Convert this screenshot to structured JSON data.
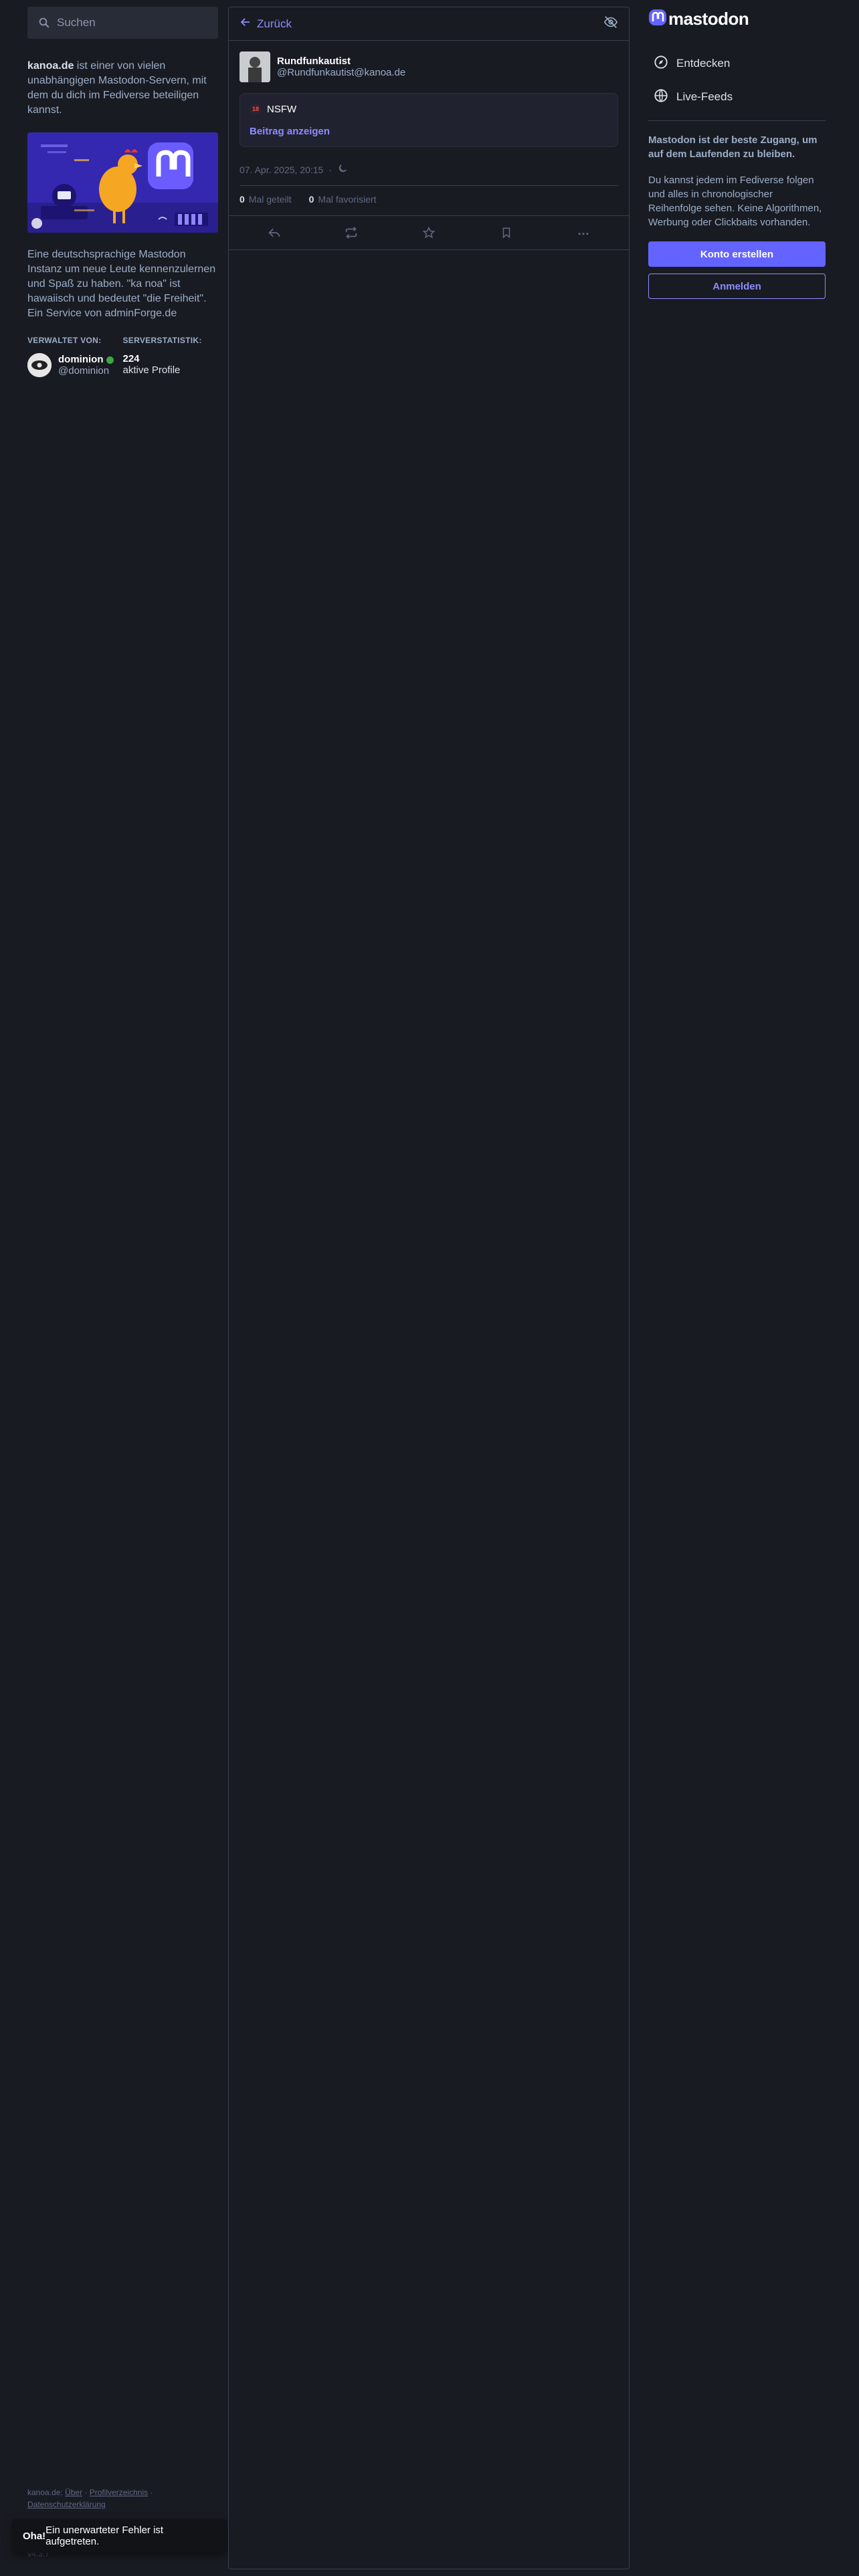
{
  "search": {
    "placeholder": "Suchen"
  },
  "about": {
    "domain": "kanoa.de",
    "text": " ist einer von vielen unabhängigen Mastodon-Servern, mit dem du dich im Fediverse beteiligen kannst."
  },
  "description": "Eine deutschsprachige Mastodon Instanz um neue Leute kennenzulernen und Spaß zu haben. \"ka noa\" ist hawaiisch und bedeutet \"die Freiheit\". Ein Service von adminForge.de",
  "admin": {
    "heading": "VERWALTET VON:",
    "name": "dominion",
    "handle": "@dominion"
  },
  "stats": {
    "heading": "SERVERSTATISTIK:",
    "count": "224",
    "label": "aktive Profile"
  },
  "footer": {
    "prefix": "kanoa.de:",
    "about": "Über",
    "directory": "Profilverzeichnis",
    "privacy": "Datenschutzerklärung",
    "version": "v4.3.7"
  },
  "toast": {
    "bold": "Oha!",
    "text": " Ein unerwarteter Fehler ist aufgetreten."
  },
  "column": {
    "back": "Zurück"
  },
  "status": {
    "display_name": "Rundfunkautist",
    "handle": "@Rundfunkautist@kanoa.de",
    "cw_badge": "18",
    "cw_label": "NSFW",
    "show_more": "Beitrag anzeigen",
    "timestamp": "07. Apr. 2025, 20:15",
    "boosts": "0",
    "boosts_label": "Mal geteilt",
    "favourites": "0",
    "favourites_label": "Mal favorisiert"
  },
  "right": {
    "logo": "mastodon",
    "nav": [
      "Entdecken",
      "Live-Feeds"
    ],
    "pitch_bold": "Mastodon ist der beste Zugang, um auf dem Laufenden zu bleiben.",
    "pitch": "Du kannst jedem im Fediverse folgen und alles in chronologischer Reihenfolge sehen. Keine Algorithmen, Werbung oder Clickbaits vorhanden.",
    "signup": "Konto erstellen",
    "login": "Anmelden"
  },
  "colors": {
    "accent": "#6364ff",
    "link": "#8c8dff",
    "background": "#191b22"
  }
}
